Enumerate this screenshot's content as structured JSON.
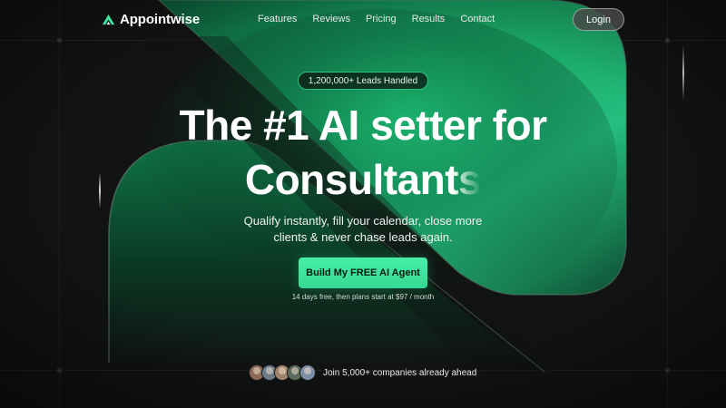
{
  "header": {
    "logo_text": "Appointwise",
    "logo_icon": "mountain-logo-icon",
    "nav": [
      {
        "label": "Features"
      },
      {
        "label": "Reviews"
      },
      {
        "label": "Pricing"
      },
      {
        "label": "Results"
      },
      {
        "label": "Contact"
      }
    ],
    "login_label": "Login"
  },
  "hero": {
    "badge": "1,200,000+ Leads Handled",
    "headline_line1": "The #1 AI setter for",
    "headline_line2": "Consultants",
    "subline_line1": "Qualify instantly, fill your calendar, close more",
    "subline_line2": "clients & never chase leads again.",
    "cta_label": "Build My FREE AI Agent",
    "cta_note": "14 days free, then plans start at $97 / month"
  },
  "social_proof": {
    "text": "Join 5,000+ companies already ahead",
    "avatar_count": 5
  },
  "colors": {
    "accent": "#3ee8a0",
    "accent_border": "#2fbf7d",
    "background": "#121413",
    "green_glow": "#0f7a4a"
  }
}
